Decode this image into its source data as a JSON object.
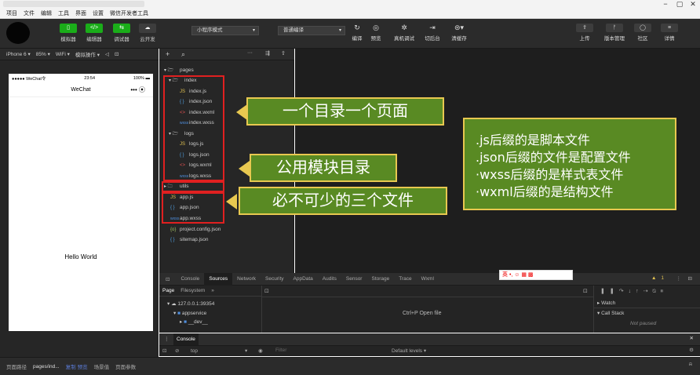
{
  "window": {
    "buttons": [
      "−",
      "▢",
      "✕"
    ]
  },
  "menu": [
    "项目",
    "文件",
    "编辑",
    "工具",
    "界面",
    "设置",
    "微信开发者工具"
  ],
  "toolbar": {
    "left_buttons": [
      {
        "label": "模拟器",
        "icon": "phone-icon"
      },
      {
        "label": "编辑器",
        "icon": "code-icon"
      },
      {
        "label": "调试器",
        "icon": "debug-icon"
      },
      {
        "label": "云开发",
        "icon": "cloud-icon"
      }
    ],
    "mode_select": "小程序模式",
    "compile_select": "普通编译",
    "mid_buttons": [
      {
        "label": "编译",
        "icon": "refresh-icon"
      },
      {
        "label": "预览",
        "icon": "eye-icon"
      },
      {
        "label": "真机调试",
        "icon": "bug-icon"
      },
      {
        "label": "切后台",
        "icon": "switch-icon"
      },
      {
        "label": "清缓存",
        "icon": "clear-icon"
      }
    ],
    "right_buttons": [
      {
        "label": "上传",
        "icon": "upload-icon"
      },
      {
        "label": "版本管理",
        "icon": "branch-icon"
      },
      {
        "label": "社区",
        "icon": "chat-icon"
      },
      {
        "label": "详情",
        "icon": "menu-icon"
      }
    ]
  },
  "simbar": {
    "device": "iPhone 6",
    "zoom": "85%",
    "network": "WiFi",
    "ops": "模拟操作"
  },
  "phone": {
    "carrier": "●●●●● WeChat令",
    "time": "23:54",
    "battery": "100%",
    "title": "WeChat",
    "capsule": "••• ⦿",
    "body_text": "Hello World"
  },
  "explorer": {
    "toolbar": {
      "add": "+",
      "search": "⌕",
      "more": "···",
      "split": "⇶",
      "collapse": "⇧"
    },
    "tree": [
      {
        "kind": "folder",
        "name": "pages",
        "open": true,
        "depth": 0
      },
      {
        "kind": "folder",
        "name": "index",
        "open": true,
        "depth": 1
      },
      {
        "kind": "js",
        "name": "index.js",
        "depth": 2
      },
      {
        "kind": "json",
        "name": "index.json",
        "depth": 2
      },
      {
        "kind": "wxml",
        "name": "index.wxml",
        "depth": 2
      },
      {
        "kind": "wxss",
        "name": "index.wxss",
        "depth": 2
      },
      {
        "kind": "folder",
        "name": "logs",
        "open": true,
        "depth": 1
      },
      {
        "kind": "js",
        "name": "logs.js",
        "depth": 2
      },
      {
        "kind": "json",
        "name": "logs.json",
        "depth": 2
      },
      {
        "kind": "wxml",
        "name": "logs.wxml",
        "depth": 2
      },
      {
        "kind": "wxss",
        "name": "logs.wxss",
        "depth": 2
      },
      {
        "kind": "folder",
        "name": "utils",
        "open": false,
        "depth": 0
      },
      {
        "kind": "js",
        "name": "app.js",
        "depth": 0
      },
      {
        "kind": "json",
        "name": "app.json",
        "depth": 0
      },
      {
        "kind": "wxss",
        "name": "app.wxss",
        "depth": 0
      },
      {
        "kind": "config",
        "name": "project.config.json",
        "depth": 0
      },
      {
        "kind": "json",
        "name": "sitemap.json",
        "depth": 0
      }
    ]
  },
  "annotations": {
    "pages": "一个目录一个页面",
    "utils": "公用模块目录",
    "app": "必不可少的三个文件"
  },
  "note": [
    ".js后缀的是脚本文件",
    ".json后缀的文件是配置文件",
    "·wxss后缀的是样式表文件",
    "·wxml后缀的是结构文件"
  ],
  "devtools": {
    "tabs": [
      "Console",
      "Sources",
      "Network",
      "Security",
      "AppData",
      "Audits",
      "Sensor",
      "Storage",
      "Trace",
      "Wxml"
    ],
    "active_tab": "Sources",
    "warning_count": "1",
    "subtabs": [
      "Page",
      "Filesystem",
      "»"
    ],
    "tree": [
      "127.0.0.1:39354",
      "appservice",
      "__dev__"
    ],
    "open_file_hint": "Ctrl+P   Open file",
    "watch": "Watch",
    "callstack": "Call Stack",
    "not_paused": "Not paused",
    "console_tab": "Console",
    "context": "top",
    "filter_placeholder": "Filter",
    "levels": "Default levels ▾"
  },
  "ime": "英 •, ☺ ▦ ▩",
  "footer": {
    "path_label": "页面路径",
    "path": "pages/ind...",
    "copy": "复制",
    "preview": "预览",
    "scene": "场景值",
    "params": "页面参数"
  }
}
